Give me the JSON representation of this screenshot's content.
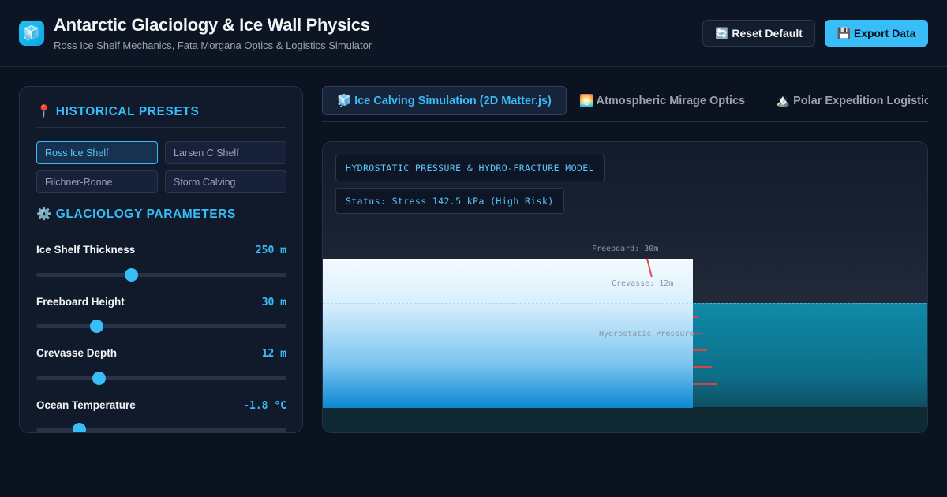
{
  "header": {
    "logo_icon": "🧊",
    "title": "Antarctic Glaciology & Ice Wall Physics",
    "subtitle": "Ross Ice Shelf Mechanics, Fata Morgana Optics & Logistics Simulator",
    "reset_label": "🔄 Reset Default",
    "export_label": "💾 Export Data"
  },
  "sidebar": {
    "presets_title": "📍 HISTORICAL PRESETS",
    "presets": [
      {
        "label": "Ross Ice Shelf",
        "active": true
      },
      {
        "label": "Larsen C Shelf",
        "active": false
      },
      {
        "label": "Filchner-Ronne",
        "active": false
      },
      {
        "label": "Storm Calving",
        "active": false
      }
    ],
    "params_title": "⚙️ GLACIOLOGY PARAMETERS",
    "params": [
      {
        "label": "Ice Shelf Thickness",
        "value": "250 m",
        "level": 0.38
      },
      {
        "label": "Freeboard Height",
        "value": "30 m",
        "level": 0.24
      },
      {
        "label": "Crevasse Depth",
        "value": "12 m",
        "level": 0.25
      },
      {
        "label": "Ocean Temperature",
        "value": "-1.8 °C",
        "level": 0.17
      }
    ]
  },
  "tabs": [
    {
      "label": "🧊 Ice Calving Simulation (2D Matter.js)",
      "active": true
    },
    {
      "label": "🌅 Atmospheric Mirage Optics",
      "active": false
    },
    {
      "label": "🏔️ Polar Expedition Logistics",
      "active": false
    }
  ],
  "simulation": {
    "model_title": "HYDROSTATIC PRESSURE & HYDRO-FRACTURE MODEL",
    "status": "Status: Stress 142.5 kPa (High Risk)",
    "freeboard_label": "Freeboard: 30m",
    "crevasse_label": "Crevasse: 12m",
    "pressure_label": "Hydrostatic Pressure",
    "colors": {
      "ice_top": "#f5fbff",
      "ice_bottom": "#0b88d4",
      "ocean": "#0f8aa8",
      "accent": "#38bdf8",
      "stress": "#d64545"
    }
  }
}
